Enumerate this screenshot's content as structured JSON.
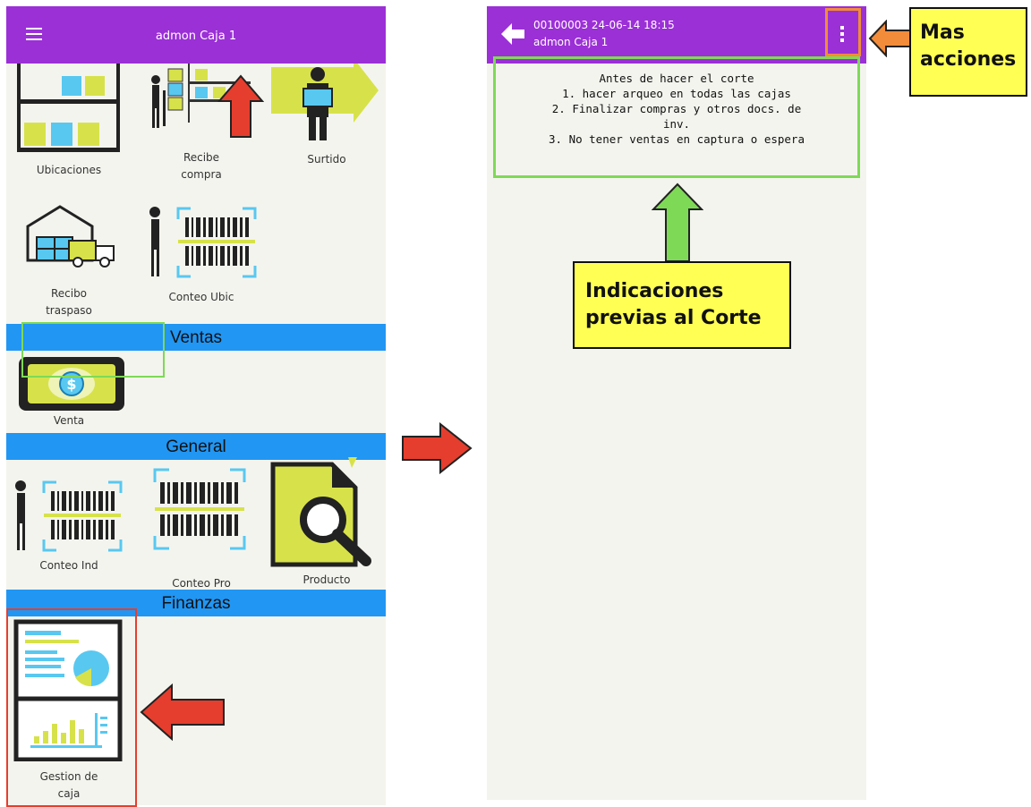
{
  "left_screen": {
    "title": "admon Caja 1",
    "tiles": {
      "ubicaciones": "Ubicaciones",
      "recibe_compra": "Recibe\ncompra",
      "surtido": "Surtido",
      "recibo_traspaso": "Recibo\ntraspaso",
      "conteo_ubic": "Conteo Ubic",
      "venta": "Venta",
      "conteo_ind": "Conteo Ind",
      "conteo_pro": "Conteo Pro",
      "producto": "Producto",
      "gestion_caja": "Gestion de\ncaja"
    },
    "sections": {
      "ventas": "Ventas",
      "general": "General",
      "finanzas": "Finanzas"
    }
  },
  "right_screen": {
    "title_line1": "00100003 24-06-14 18:15",
    "title_line2": "admon Caja 1",
    "instructions": [
      "Antes de hacer el corte",
      "1. hacer arqueo en todas las cajas",
      "2. Finalizar compras y otros docs. de",
      "inv.",
      "3. No tener ventas en captura o espera"
    ]
  },
  "callouts": {
    "mas_acciones_line1": "Mas",
    "mas_acciones_line2": "acciones",
    "indicaciones_line1": "Indicaciones",
    "indicaciones_line2": "previas al Corte"
  },
  "colors": {
    "appbar": "#9b30d6",
    "section": "#2196f3",
    "highlight_green": "#7ed957",
    "highlight_red": "#e53e2e",
    "arrow_orange": "#f28c3a",
    "callout_yellow": "#ffff54",
    "icon_lime": "#d7e24a",
    "icon_blue": "#58c8f0"
  }
}
